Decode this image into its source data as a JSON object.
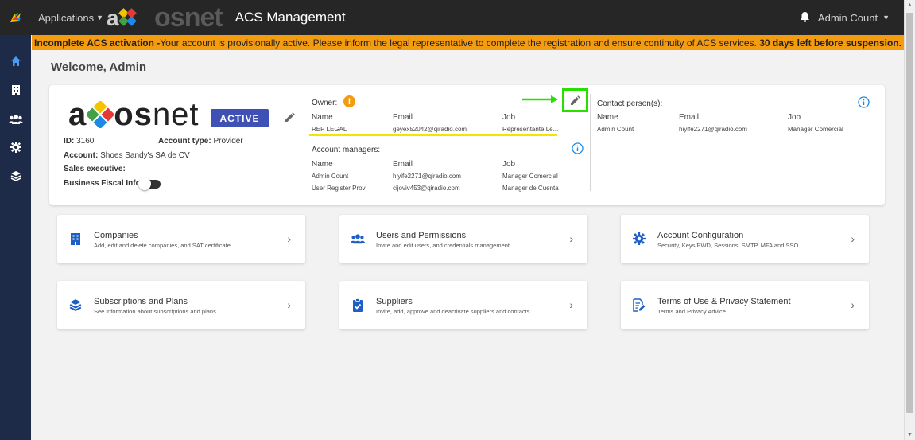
{
  "header": {
    "applications_label": "Applications",
    "brand_ghost": "axosnet",
    "title": "ACS Management",
    "user_name": "Admin Count"
  },
  "banner": {
    "lead": "Incomplete ACS activation -",
    "message": "Your account is provisionally active. Please inform the legal representative to complete the registration and ensure continuity of ACS services.",
    "countdown": "30 days left before suspension."
  },
  "sidenav": {
    "items": [
      "home-icon",
      "building-icon",
      "users-icon",
      "gear-icon",
      "layers-icon"
    ]
  },
  "welcome": "Welcome, Admin",
  "account": {
    "brand": {
      "bold": "axos",
      "light": "net"
    },
    "status": "ACTIVE",
    "id_label": "ID:",
    "id_value": "3160",
    "type_label": "Account type:",
    "type_value": "Provider",
    "account_label": "Account:",
    "account_value": "Shoes Sandy's SA de CV",
    "sales_label": "Sales executive:",
    "fiscal_label": "Business Fiscal Info:"
  },
  "owner": {
    "label": "Owner:",
    "warning": "!",
    "headers": {
      "name": "Name",
      "email": "Email",
      "job": "Job"
    },
    "row": {
      "name": "REP LEGAL",
      "email": "geyex52042@qiradio.com",
      "job": "Representante Le..."
    }
  },
  "managers": {
    "label": "Account managers:",
    "headers": {
      "name": "Name",
      "email": "Email",
      "job": "Job"
    },
    "rows": [
      {
        "name": "Admin Count",
        "email": "hiyife2271@qiradio.com",
        "job": "Manager Comercial"
      },
      {
        "name": "User Register Prov",
        "email": "cijoviv453@qiradio.com",
        "job": "Manager de Cuenta"
      }
    ]
  },
  "contacts": {
    "label": "Contact person(s):",
    "headers": {
      "name": "Name",
      "email": "Email",
      "job": "Job"
    },
    "row": {
      "name": "Admin Count",
      "email": "hiyife2271@qiradio.com",
      "job": "Manager Comercial"
    }
  },
  "tiles": [
    {
      "icon": "building-icon",
      "title": "Companies",
      "desc": "Add, edit and delete companies, and SAT certificate"
    },
    {
      "icon": "users-icon",
      "title": "Users and Permissions",
      "desc": "Invite and edit users, and credentials management"
    },
    {
      "icon": "gear-icon",
      "title": "Account Configuration",
      "desc": "Security, Keys/PWD, Sessions, SMTP, MFA and SSO"
    },
    {
      "icon": "layers-icon",
      "title": "Subscriptions and Plans",
      "desc": "See information about subscriptions and plans"
    },
    {
      "icon": "clipboard-check-icon",
      "title": "Suppliers",
      "desc": "Invite, add, approve and deactivate suppliers and contacts"
    },
    {
      "icon": "document-edit-icon",
      "title": "Terms of Use & Privacy Statement",
      "desc": "Terms and Privacy Advice"
    }
  ],
  "colors": {
    "accent": "#3f51b5",
    "nav_bg": "#1d2b48",
    "banner_bg": "#f39c12",
    "highlight_box": "#27e000",
    "underline": "#f2e600"
  }
}
